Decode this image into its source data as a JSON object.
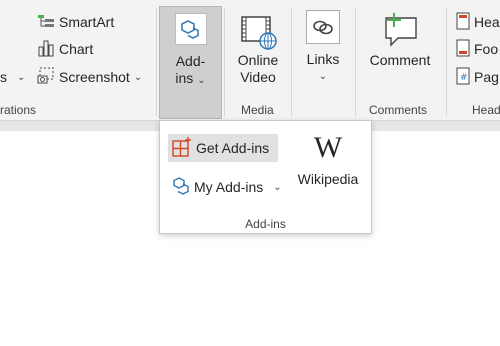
{
  "illustrations": {
    "smartart": "SmartArt",
    "chart": "Chart",
    "screenshot": "Screenshot",
    "partial_left_text": "s",
    "group_label": "rations"
  },
  "addins": {
    "label_line1": "Add-",
    "label_line2": "ins"
  },
  "media": {
    "online_video_line1": "Online",
    "online_video_line2": "Video",
    "group_label": "Media"
  },
  "links": {
    "label": "Links"
  },
  "comments": {
    "comment": "Comment",
    "group_label": "Comments"
  },
  "header_footer": {
    "header": "Hea",
    "footer": "Foo",
    "page_number": "Pag",
    "group_label": "Head"
  },
  "dropdown": {
    "get_addins": "Get Add-ins",
    "my_addins": "My Add-ins",
    "wikipedia_logo": "W",
    "wikipedia": "Wikipedia",
    "group_label": "Add-ins"
  },
  "colors": {
    "accent_orange": "#d24726",
    "accent_blue": "#2e75b6",
    "accent_green": "#4caf50"
  }
}
